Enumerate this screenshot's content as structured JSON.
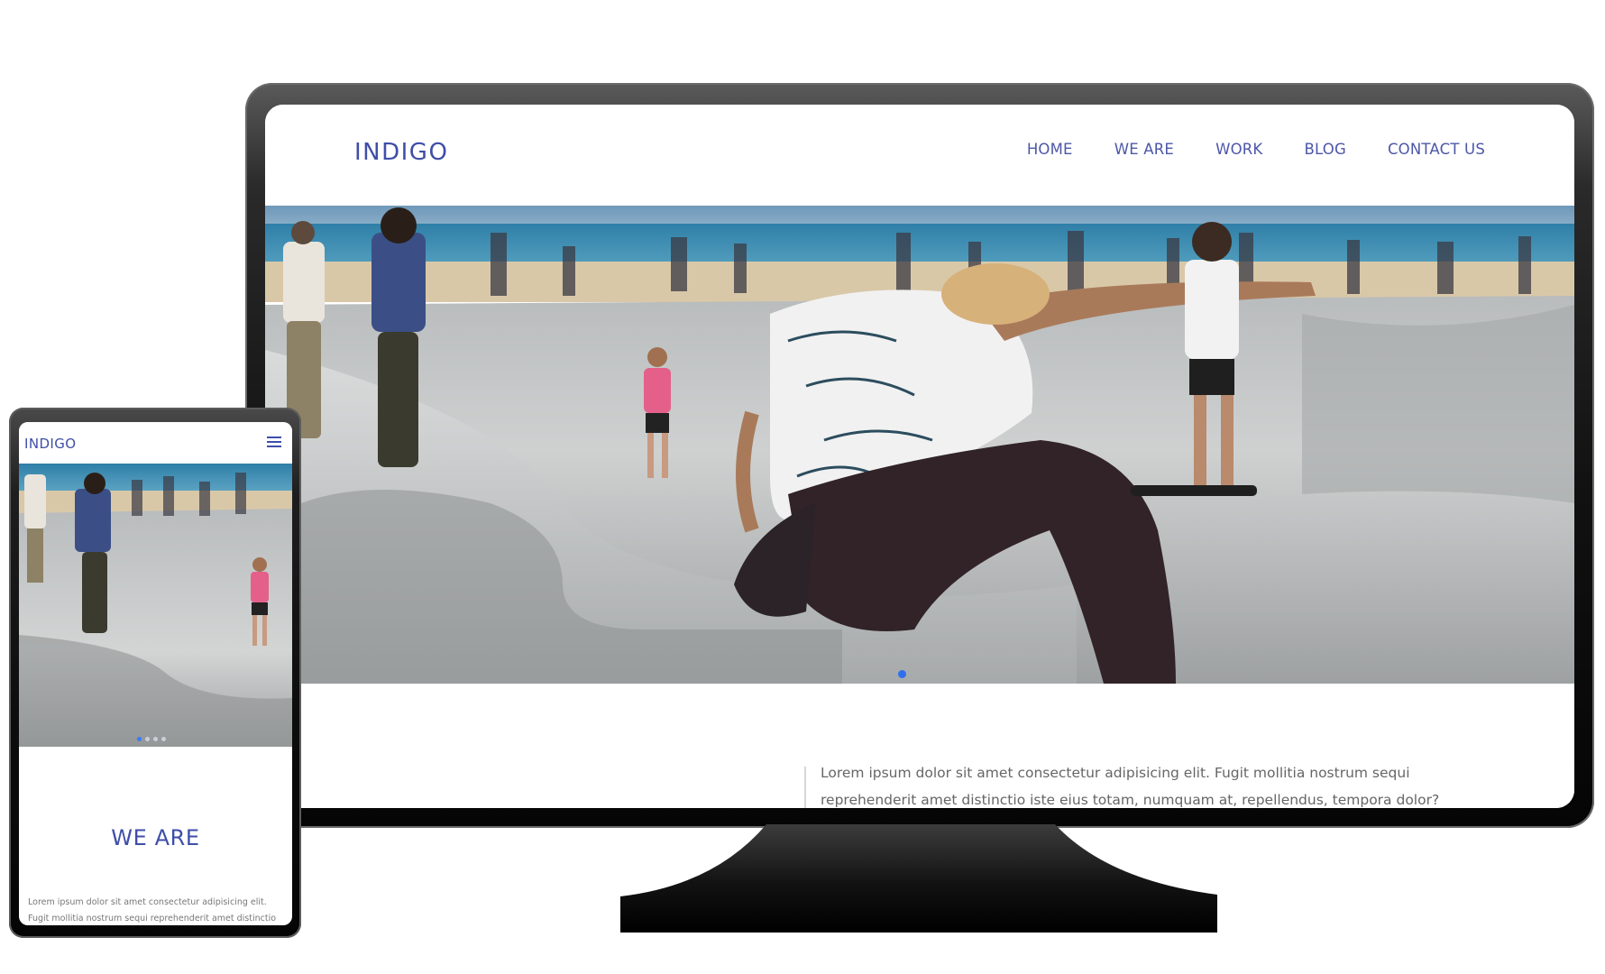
{
  "desktop": {
    "logo": "INDIGO",
    "nav": [
      {
        "label": "HOME"
      },
      {
        "label": "WE ARE"
      },
      {
        "label": "WORK"
      },
      {
        "label": "BLOG"
      },
      {
        "label": "CONTACT US"
      }
    ],
    "hero": {
      "slide_count": 4,
      "active_slide": 1
    },
    "intro_text": "Lorem ipsum dolor sit amet consectetur adipisicing elit. Fugit mollitia nostrum sequi reprehenderit amet distinctio iste eius totam, numquam at, repellendus, tempora dolor?"
  },
  "mobile": {
    "logo": "INDIGO",
    "menu_icon": "hamburger-icon",
    "hero": {
      "slide_count": 4,
      "active_slide": 1
    },
    "section_title": "WE ARE",
    "intro_text": "Lorem ipsum dolor sit amet consectetur adipisicing elit. Fugit mollitia nostrum sequi reprehenderit amet distinctio iste eius"
  },
  "colors": {
    "brand": "#3f4ea8",
    "nav_text": "#4d57a8",
    "body_text": "#666666",
    "active_dot": "#3a7bff",
    "device_frame": "#111111"
  }
}
